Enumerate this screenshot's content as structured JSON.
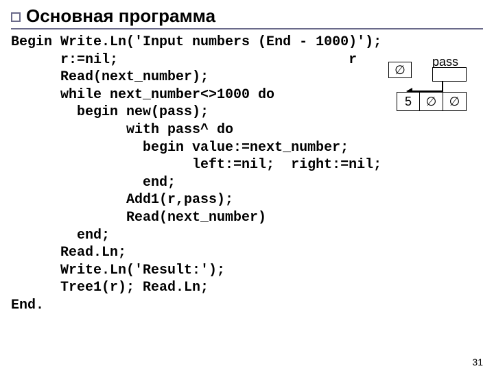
{
  "title": "Основная программа",
  "code_lines": [
    "Begin Write.Ln('Input numbers (End - 1000)');",
    "      r:=nil;                            r",
    "      Read(next_number);",
    "      while next_number<>1000 do",
    "        begin new(pass);",
    "              with pass^ do",
    "                begin value:=next_number;",
    "                      left:=nil;  right:=nil;",
    "                end;",
    "              Add1(r,pass);",
    "              Read(next_number)",
    "        end;",
    "      Read.Ln;",
    "      Write.Ln('Result:');",
    "      Tree1(r); Read.Ln;",
    "End."
  ],
  "diagram": {
    "label_r": "r",
    "label_pass": "pass",
    "nil_symbol": "∅",
    "node_value": "5"
  },
  "page_number": "31"
}
